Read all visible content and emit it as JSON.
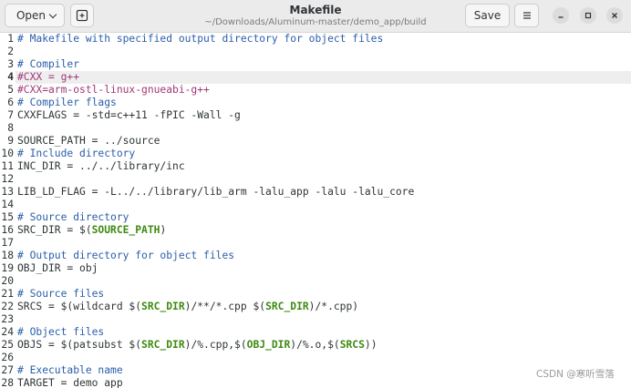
{
  "header": {
    "open_label": "Open",
    "save_label": "Save",
    "title": "Makefile",
    "path": "~/Downloads/Aluminum-master/demo_app/build"
  },
  "colors": {
    "comment": "#2a5eaa",
    "preprocessor": "#a1387a",
    "variable": "#3e8a10",
    "current_line": "#eeeeee"
  },
  "editor": {
    "current_line": 4,
    "lines": [
      {
        "n": "1",
        "seg": [
          {
            "t": "# Makefile with specified output directory for object files",
            "c": "c"
          }
        ]
      },
      {
        "n": "2",
        "seg": []
      },
      {
        "n": "3",
        "seg": [
          {
            "t": "# Compiler",
            "c": "c"
          }
        ]
      },
      {
        "n": "4",
        "seg": [
          {
            "t": "#CXX = g++",
            "c": "pp"
          }
        ]
      },
      {
        "n": "5",
        "seg": [
          {
            "t": "#CXX=arm-ostl-linux-gnueabi-g++",
            "c": "pp"
          }
        ]
      },
      {
        "n": "6",
        "seg": [
          {
            "t": "# Compiler flags",
            "c": "c"
          }
        ]
      },
      {
        "n": "7",
        "seg": [
          {
            "t": "CXXFLAGS = -std=c++11 -fPIC -Wall -g",
            "c": ""
          }
        ]
      },
      {
        "n": "8",
        "seg": []
      },
      {
        "n": "9",
        "seg": [
          {
            "t": "SOURCE_PATH = ../source",
            "c": ""
          }
        ]
      },
      {
        "n": "10",
        "seg": [
          {
            "t": "# Include directory",
            "c": "c"
          }
        ]
      },
      {
        "n": "11",
        "seg": [
          {
            "t": "INC_DIR = ../../library/inc",
            "c": ""
          }
        ]
      },
      {
        "n": "12",
        "seg": []
      },
      {
        "n": "13",
        "seg": [
          {
            "t": "LIB_LD_FLAG = -L../../library/lib_arm -lalu_app -lalu -lalu_core",
            "c": ""
          }
        ]
      },
      {
        "n": "14",
        "seg": []
      },
      {
        "n": "15",
        "seg": [
          {
            "t": "# Source directory",
            "c": "c"
          }
        ]
      },
      {
        "n": "16",
        "seg": [
          {
            "t": "SRC_DIR = $(",
            "c": ""
          },
          {
            "t": "SOURCE_PATH",
            "c": "v"
          },
          {
            "t": ")",
            "c": ""
          }
        ]
      },
      {
        "n": "17",
        "seg": []
      },
      {
        "n": "18",
        "seg": [
          {
            "t": "# Output directory for object files",
            "c": "c"
          }
        ]
      },
      {
        "n": "19",
        "seg": [
          {
            "t": "OBJ_DIR = obj",
            "c": ""
          }
        ]
      },
      {
        "n": "20",
        "seg": []
      },
      {
        "n": "21",
        "seg": [
          {
            "t": "# Source files",
            "c": "c"
          }
        ]
      },
      {
        "n": "22",
        "seg": [
          {
            "t": "SRCS = $(wildcard $(",
            "c": ""
          },
          {
            "t": "SRC_DIR",
            "c": "v"
          },
          {
            "t": ")/**/*.cpp $(",
            "c": ""
          },
          {
            "t": "SRC_DIR",
            "c": "v"
          },
          {
            "t": ")/*.cpp)",
            "c": ""
          }
        ]
      },
      {
        "n": "23",
        "seg": []
      },
      {
        "n": "24",
        "seg": [
          {
            "t": "# Object files",
            "c": "c"
          }
        ]
      },
      {
        "n": "25",
        "seg": [
          {
            "t": "OBJS = $(patsubst $(",
            "c": ""
          },
          {
            "t": "SRC_DIR",
            "c": "v"
          },
          {
            "t": ")/%.cpp,$(",
            "c": ""
          },
          {
            "t": "OBJ_DIR",
            "c": "v"
          },
          {
            "t": ")/%.o,$(",
            "c": ""
          },
          {
            "t": "SRCS",
            "c": "v"
          },
          {
            "t": "))",
            "c": ""
          }
        ]
      },
      {
        "n": "26",
        "seg": []
      },
      {
        "n": "27",
        "seg": [
          {
            "t": "# Executable name",
            "c": "c"
          }
        ]
      },
      {
        "n": "28",
        "seg": [
          {
            "t": "TARGET = demo_app",
            "c": ""
          }
        ]
      }
    ]
  },
  "watermark": "CSDN @寒听雪落"
}
